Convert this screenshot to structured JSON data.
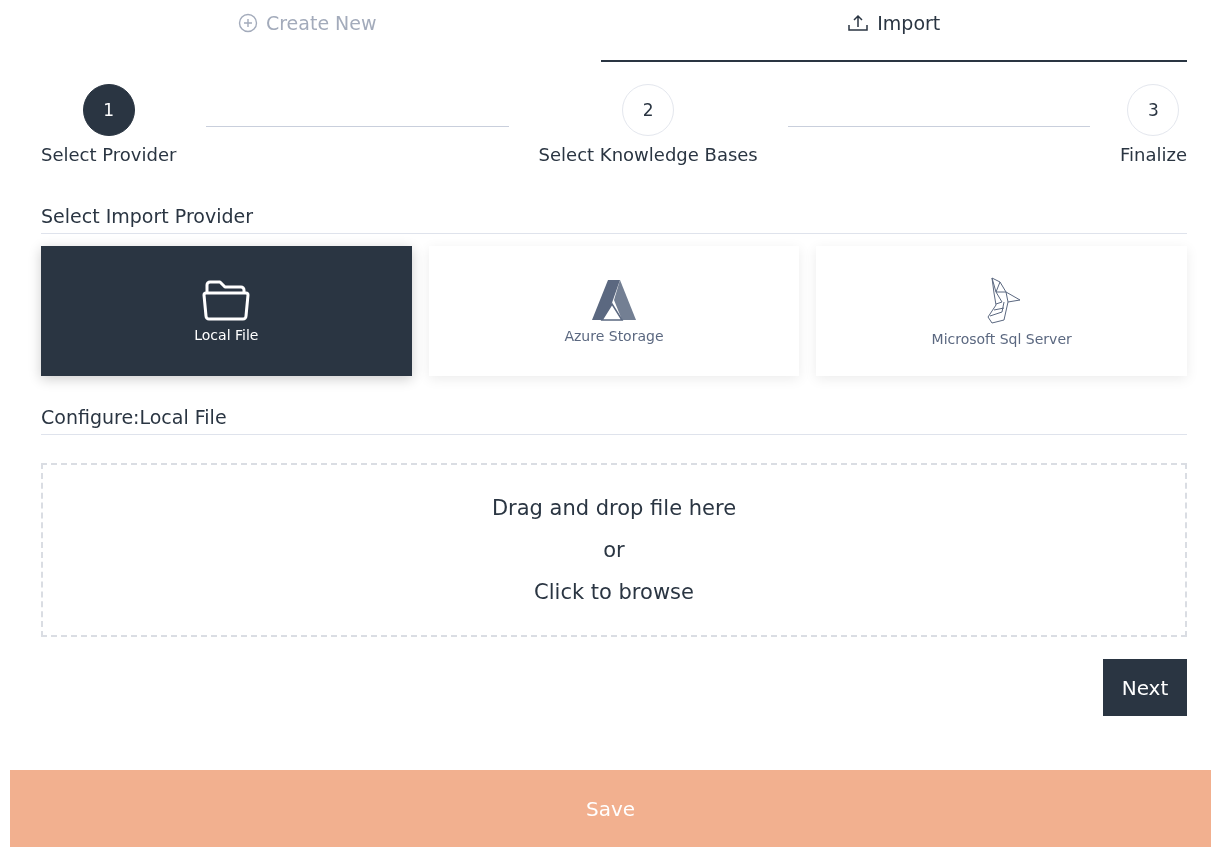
{
  "tabs": [
    {
      "label": "Create New",
      "kind": "plus",
      "selected": false
    },
    {
      "label": "Import",
      "kind": "upload",
      "selected": true
    }
  ],
  "steps": [
    {
      "number": "1",
      "label": "Select Provider",
      "selected": true
    },
    {
      "number": "2",
      "label": "Select Knowledge Bases",
      "selected": false
    },
    {
      "number": "3",
      "label": "Finalize",
      "selected": false
    }
  ],
  "provider_section": {
    "title": "Select Import Provider"
  },
  "providers": [
    {
      "kind": "folder",
      "label": "Local File",
      "selected": true
    },
    {
      "kind": "azure",
      "label": "Azure Storage",
      "selected": false
    },
    {
      "kind": "sql",
      "label": "Microsoft Sql Server",
      "selected": false
    }
  ],
  "configure": {
    "title": "Configure:Local File"
  },
  "dropzone": {
    "lines": [
      "Drag and drop file here",
      "or",
      "Click to browse"
    ]
  },
  "next_button": "Next",
  "save_button": "Save"
}
